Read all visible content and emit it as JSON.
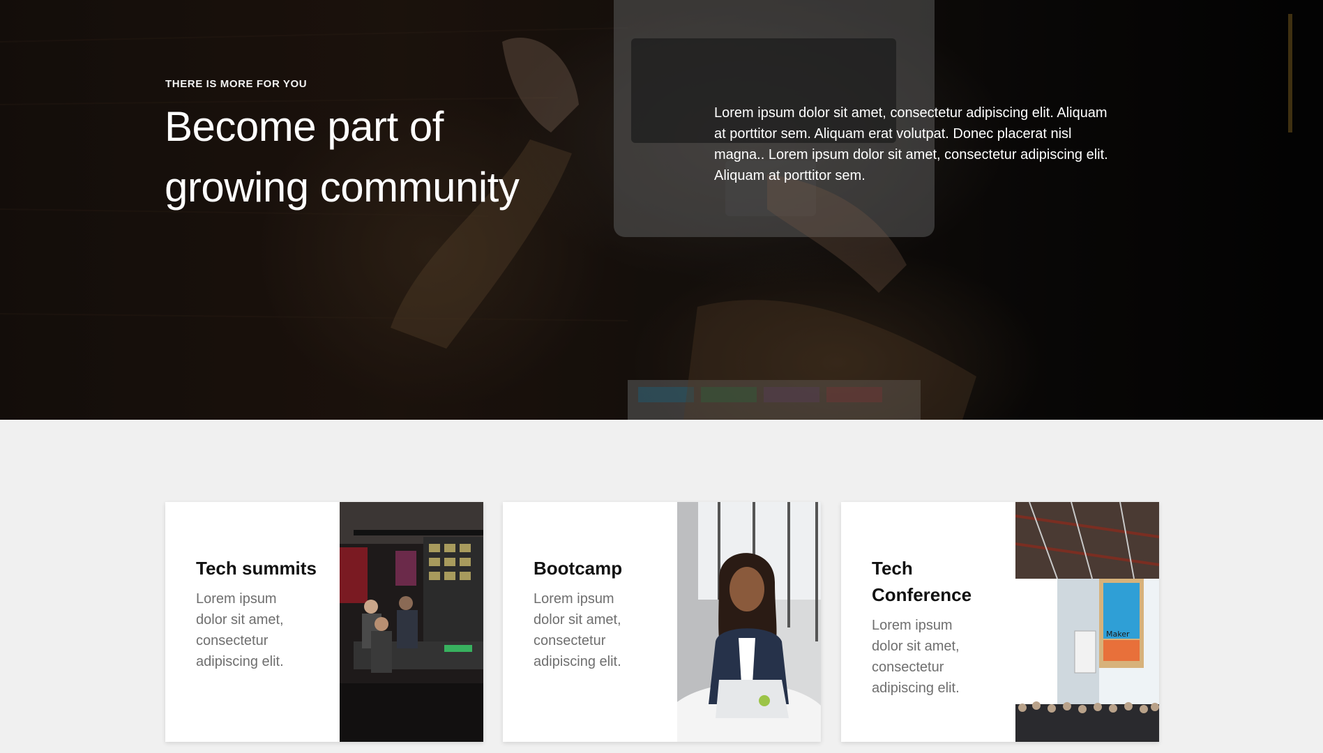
{
  "hero": {
    "eyebrow": "THERE IS MORE FOR YOU",
    "title": "Become part of growing community",
    "body": "Lorem ipsum dolor sit amet, consectetur adipiscing elit. Aliquam at porttitor sem. Aliquam erat volutpat. Donec placerat nisl magna.. Lorem ipsum dolor sit amet, consectetur adipiscing elit. Aliquam at porttitor sem."
  },
  "cards": [
    {
      "title": "Tech summits",
      "text": "Lorem ipsum dolor sit amet, consectetur adipiscing elit."
    },
    {
      "title": "Bootcamp",
      "text": "Lorem ipsum dolor sit amet, consectetur adipiscing elit."
    },
    {
      "title": "Tech Conference",
      "text": "Lorem ipsum dolor sit amet, consectetur adipiscing elit."
    }
  ],
  "colors": {
    "hero_overlay": "#000000",
    "page_bg": "#f0f0f0",
    "card_bg": "#ffffff",
    "card_text": "#6f6f6f",
    "card_title": "#111111",
    "sign_blue": "#2f9fd6",
    "sign_orange": "#e8703a"
  }
}
